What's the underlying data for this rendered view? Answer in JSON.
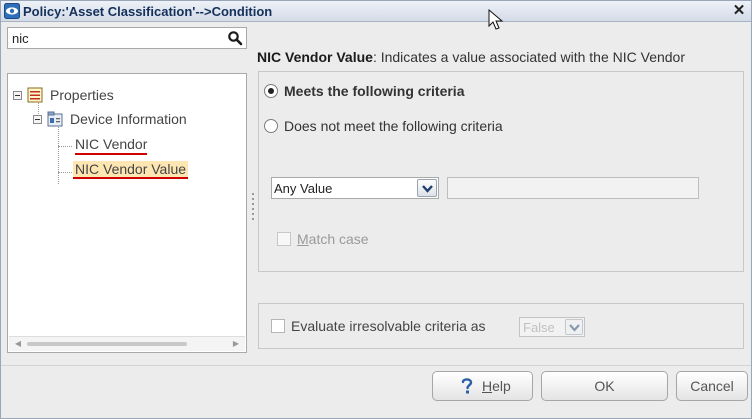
{
  "window": {
    "title": "Policy:'Asset Classification'-->Condition",
    "close_glyph": "✕"
  },
  "search": {
    "value": "nic"
  },
  "tree": {
    "items": [
      {
        "label": "Properties",
        "icon": "properties-list-icon"
      },
      {
        "label": "Device Information",
        "icon": "device-info-icon"
      },
      {
        "label": "NIC Vendor"
      },
      {
        "label": "NIC Vendor Value",
        "selected": true
      }
    ]
  },
  "detail": {
    "field_name": "NIC Vendor Value",
    "description": ": Indicates a value associated with the NIC Vendor"
  },
  "criteria": {
    "options": [
      {
        "label": "Meets the following criteria",
        "selected": true
      },
      {
        "label": "Does not meet the following criteria",
        "selected": false
      }
    ],
    "operator": "Any Value",
    "value": "",
    "match_case_label": "Match case",
    "match_case_mnemonic": "M",
    "match_case_rest": "atch case"
  },
  "evaluate": {
    "label": "Evaluate irresolvable criteria as",
    "value": "False"
  },
  "buttons": {
    "help": "Help",
    "help_mnemonic": "H",
    "help_rest": "elp",
    "ok": "OK",
    "cancel": "Cancel"
  },
  "colors": {
    "selection_highlight": "#fde6b2",
    "search_underline": "#d10000",
    "title_text": "#15305a"
  }
}
